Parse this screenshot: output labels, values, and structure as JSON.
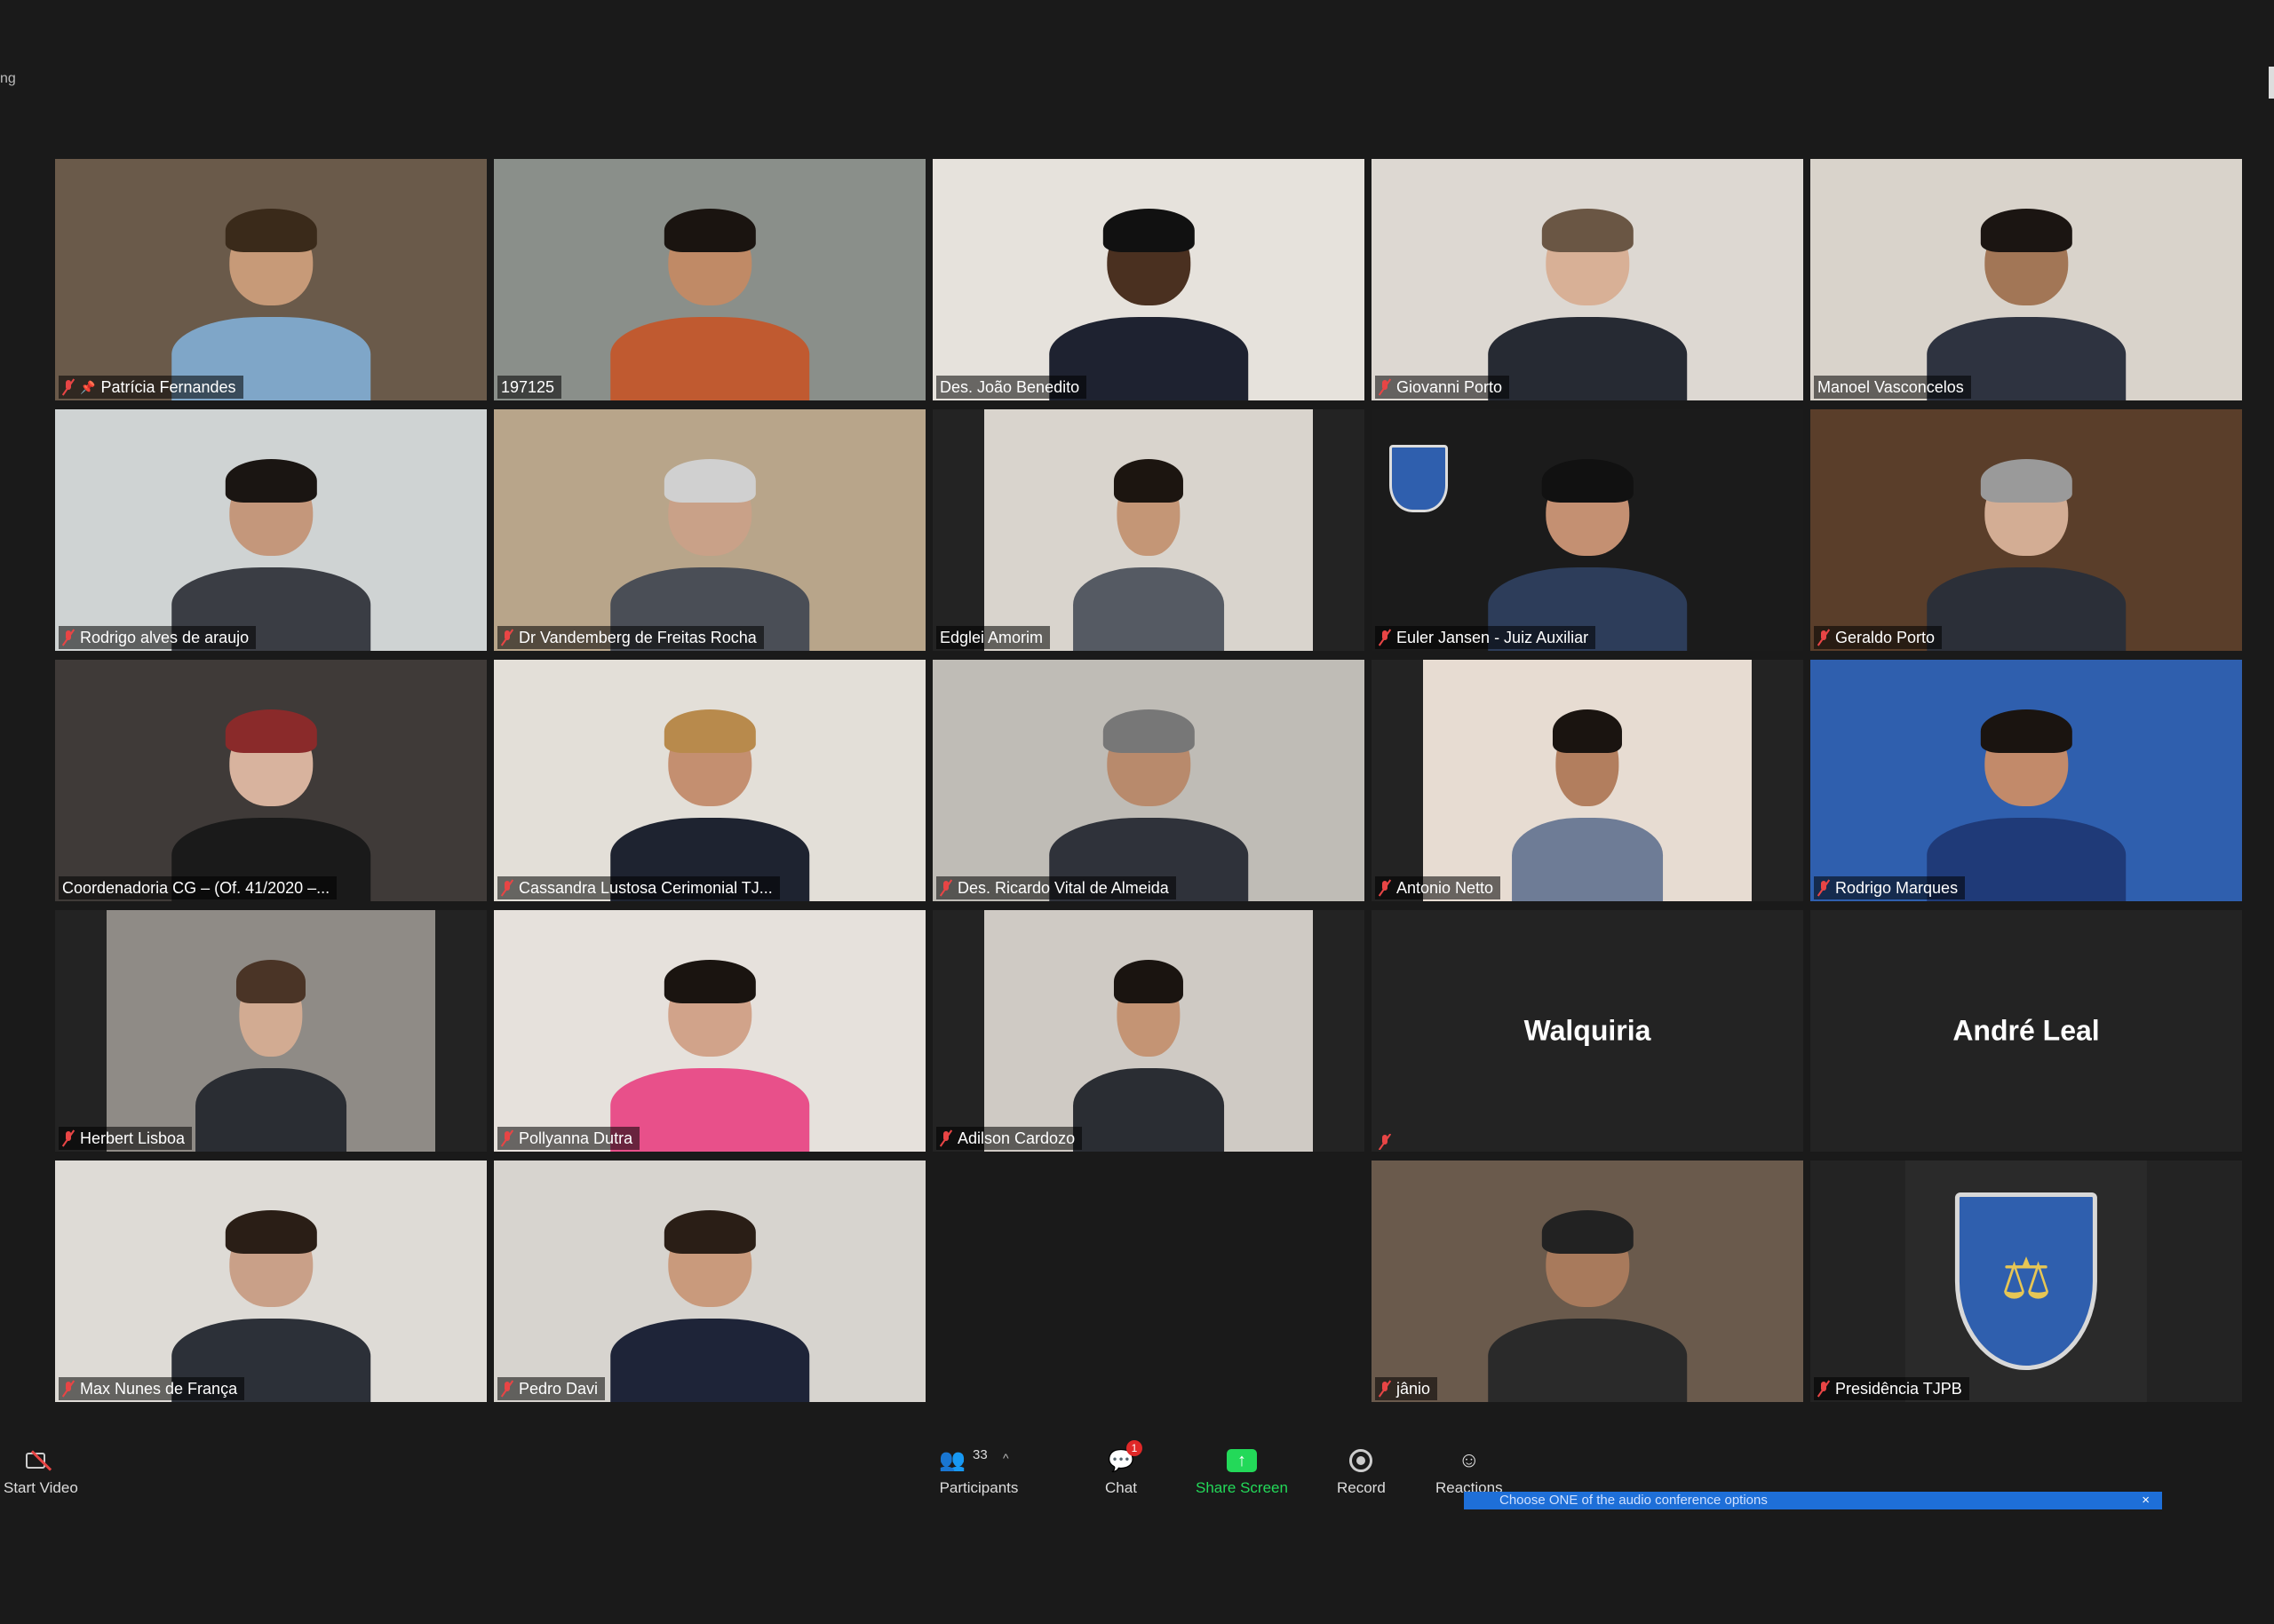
{
  "window": {
    "corner_text": "ng"
  },
  "tiles": [
    {
      "name": "Patrícia Fernandes",
      "kind": "video",
      "bg": "#6a5a4a",
      "skin": "#c79a78",
      "shirt": "#7fa6c8",
      "hair": "#3a2a1a",
      "pinned": true,
      "muted": true
    },
    {
      "name": "197125",
      "kind": "video",
      "bg": "#8a8f8a",
      "skin": "#c08a66",
      "shirt": "#c05a30",
      "hair": "#1a1410",
      "active": true,
      "muted": false
    },
    {
      "name": "Des. João Benedito",
      "kind": "video",
      "bg": "#e6e2dc",
      "skin": "#4a3020",
      "shirt": "#1e2230",
      "hair": "#111",
      "muted": false
    },
    {
      "name": "Giovanni Porto",
      "kind": "video",
      "bg": "#ddd8d2",
      "skin": "#d8b096",
      "shirt": "#262a33",
      "hair": "#6a5644",
      "muted": true
    },
    {
      "name": "Manoel Vasconcelos",
      "kind": "video",
      "bg": "#d9d3cb",
      "skin": "#a27656",
      "shirt": "#2e3340",
      "hair": "#1b1512",
      "muted": false
    },
    {
      "name": "Rodrigo alves de araujo",
      "kind": "video",
      "bg": "#cfd3d3",
      "skin": "#c4977b",
      "shirt": "#3a3d44",
      "hair": "#1a1512",
      "muted": true
    },
    {
      "name": "Dr Vandemberg de Freitas Rocha",
      "kind": "video",
      "bg": "#b8a58a",
      "skin": "#c9a188",
      "shirt": "#4a4e56",
      "hair": "#d0d0d0",
      "muted": true
    },
    {
      "name": "Edglei Amorim",
      "kind": "video",
      "bg": "#d9d4cd",
      "skin": "#c49676",
      "shirt": "#555a63",
      "hair": "#1c1510",
      "muted": false,
      "narrow": true
    },
    {
      "name": "Euler Jansen - Juiz Auxiliar",
      "kind": "video",
      "bg": "#1b1b1b",
      "skin": "#c49072",
      "shirt": "#2d3d5a",
      "hair": "#111",
      "muted": true,
      "tjpb": true
    },
    {
      "name": "Geraldo Porto",
      "kind": "video",
      "bg": "#5a3e2a",
      "skin": "#d3ad94",
      "shirt": "#2b2f38",
      "hair": "#9a9a9a",
      "muted": true
    },
    {
      "name": "Coordenadoria CG – (Of. 41/2020 –...",
      "kind": "video",
      "bg": "#3f3a38",
      "skin": "#d8b39e",
      "shirt": "#1a1a1a",
      "hair": "#8a2a2a",
      "active": true,
      "muted": false
    },
    {
      "name": "Cassandra Lustosa Cerimonial TJ...",
      "kind": "video",
      "bg": "#e3dfd8",
      "skin": "#c48f70",
      "shirt": "#1e2330",
      "hair": "#b88a4c",
      "muted": true
    },
    {
      "name": "Des. Ricardo Vital de Almeida",
      "kind": "video",
      "bg": "#bfbcb6",
      "skin": "#b88a6c",
      "shirt": "#2f323a",
      "hair": "#777",
      "muted": true
    },
    {
      "name": "Antonio Netto",
      "kind": "video",
      "bg": "#e7dcd2",
      "skin": "#b27e5e",
      "shirt": "#6e7c96",
      "hair": "#1a1410",
      "muted": true,
      "narrow": true
    },
    {
      "name": "Rodrigo Marques",
      "kind": "video",
      "bg": "#2f5fae",
      "skin": "#c28a6a",
      "shirt": "#1f3a78",
      "hair": "#1a1410",
      "muted": true
    },
    {
      "name": "Herbert Lisboa",
      "kind": "video",
      "bg": "#8f8b86",
      "skin": "#d2ab92",
      "shirt": "#2a2d33",
      "hair": "#4a3426",
      "muted": true,
      "narrow": true
    },
    {
      "name": "Pollyanna Dutra",
      "kind": "video",
      "bg": "#e6e1dc",
      "skin": "#d1a38a",
      "shirt": "#e8508a",
      "hair": "#1a1410",
      "muted": true
    },
    {
      "name": "Adilson Cardozo",
      "kind": "video",
      "bg": "#cfcac4",
      "skin": "#c49474",
      "shirt": "#2a2d33",
      "hair": "#1a1410",
      "muted": true,
      "narrow": true
    },
    {
      "name": "",
      "kind": "placeholder",
      "display": "Walquiria",
      "muted": true
    },
    {
      "name": "",
      "kind": "placeholder",
      "display": "André Leal",
      "muted": false
    },
    {
      "name": "Max Nunes de França",
      "kind": "video",
      "bg": "#dedbd6",
      "skin": "#c9a088",
      "shirt": "#2c3038",
      "hair": "#2a1e16",
      "muted": true
    },
    {
      "name": "Pedro Davi",
      "kind": "video",
      "bg": "#d7d4cf",
      "skin": "#c99a7c",
      "shirt": "#1e2438",
      "hair": "#2a1e16",
      "muted": true
    },
    {
      "name": "",
      "kind": "empty"
    },
    {
      "name": "jânio",
      "kind": "video",
      "bg": "#6a5a4c",
      "skin": "#a87a5c",
      "shirt": "#2a2a2a",
      "hair": "#222",
      "muted": true
    },
    {
      "name": "Presidência TJPB",
      "kind": "logo",
      "muted": true
    }
  ],
  "toolbar": {
    "start_video": "Start Video",
    "participants": "Participants",
    "participants_count": "33",
    "chat": "Chat",
    "chat_badge": "1",
    "share_screen": "Share Screen",
    "record": "Record",
    "reactions": "Reactions"
  },
  "audio_banner": {
    "text": "Choose ONE of the audio conference options"
  },
  "colors": {
    "active_border": "#d4e56a",
    "share_green": "#23d959",
    "muted_red": "#e84545",
    "banner_blue": "#1e6fd8"
  }
}
